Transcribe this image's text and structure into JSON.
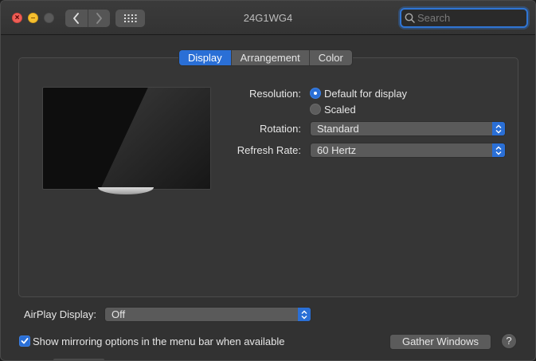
{
  "window": {
    "title": "24G1WG4"
  },
  "titlebar": {
    "close_glyph": "×",
    "minimize_glyph": "–",
    "search": {
      "placeholder": "Search",
      "value": ""
    }
  },
  "tabs": [
    {
      "label": "Display",
      "active": true
    },
    {
      "label": "Arrangement",
      "active": false
    },
    {
      "label": "Color",
      "active": false
    }
  ],
  "display": {
    "resolution_label": "Resolution:",
    "resolution_options": [
      {
        "label": "Default for display",
        "selected": true
      },
      {
        "label": "Scaled",
        "selected": false
      }
    ],
    "rotation_label": "Rotation:",
    "rotation_value": "Standard",
    "refresh_label": "Refresh Rate:",
    "refresh_value": "60 Hertz"
  },
  "airplay": {
    "label": "AirPlay Display:",
    "value": "Off"
  },
  "mirroring": {
    "label": "Show mirroring options in the menu bar when available",
    "checked": true
  },
  "buttons": {
    "gather_windows": "Gather Windows",
    "help": "?"
  },
  "colors": {
    "accent": "#2a6fd6",
    "window_bg": "#323232",
    "close": "#ee5f57",
    "minimize": "#f5bf2f"
  },
  "icons": {
    "back": "chevron-left-icon",
    "forward": "chevron-right-icon",
    "grid": "grid-icon",
    "search": "search-icon",
    "popup": "up-down-arrows-icon",
    "checkmark": "checkmark-icon"
  }
}
